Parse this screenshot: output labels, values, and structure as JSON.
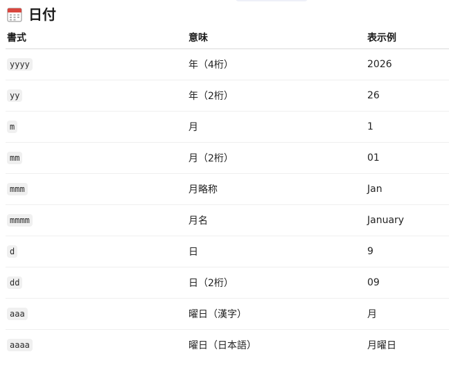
{
  "section": {
    "icon": "calendar-icon",
    "title": "日付"
  },
  "table": {
    "headers": [
      "書式",
      "意味",
      "表示例"
    ],
    "rows": [
      {
        "format": "yyyy",
        "meaning": "年（4桁）",
        "example": "2026"
      },
      {
        "format": "yy",
        "meaning": "年（2桁）",
        "example": "26"
      },
      {
        "format": "m",
        "meaning": "月",
        "example": "1"
      },
      {
        "format": "mm",
        "meaning": "月（2桁）",
        "example": "01"
      },
      {
        "format": "mmm",
        "meaning": "月略称",
        "example": "Jan"
      },
      {
        "format": "mmmm",
        "meaning": "月名",
        "example": "January"
      },
      {
        "format": "d",
        "meaning": "日",
        "example": "9"
      },
      {
        "format": "dd",
        "meaning": "日（2桁）",
        "example": "09"
      },
      {
        "format": "aaa",
        "meaning": "曜日（漢字）",
        "example": "月"
      },
      {
        "format": "aaaa",
        "meaning": "曜日（日本語）",
        "example": "月曜日"
      }
    ]
  },
  "colors": {
    "calendar_red": "#d9473f",
    "chip_bg": "#f0f0f0"
  }
}
